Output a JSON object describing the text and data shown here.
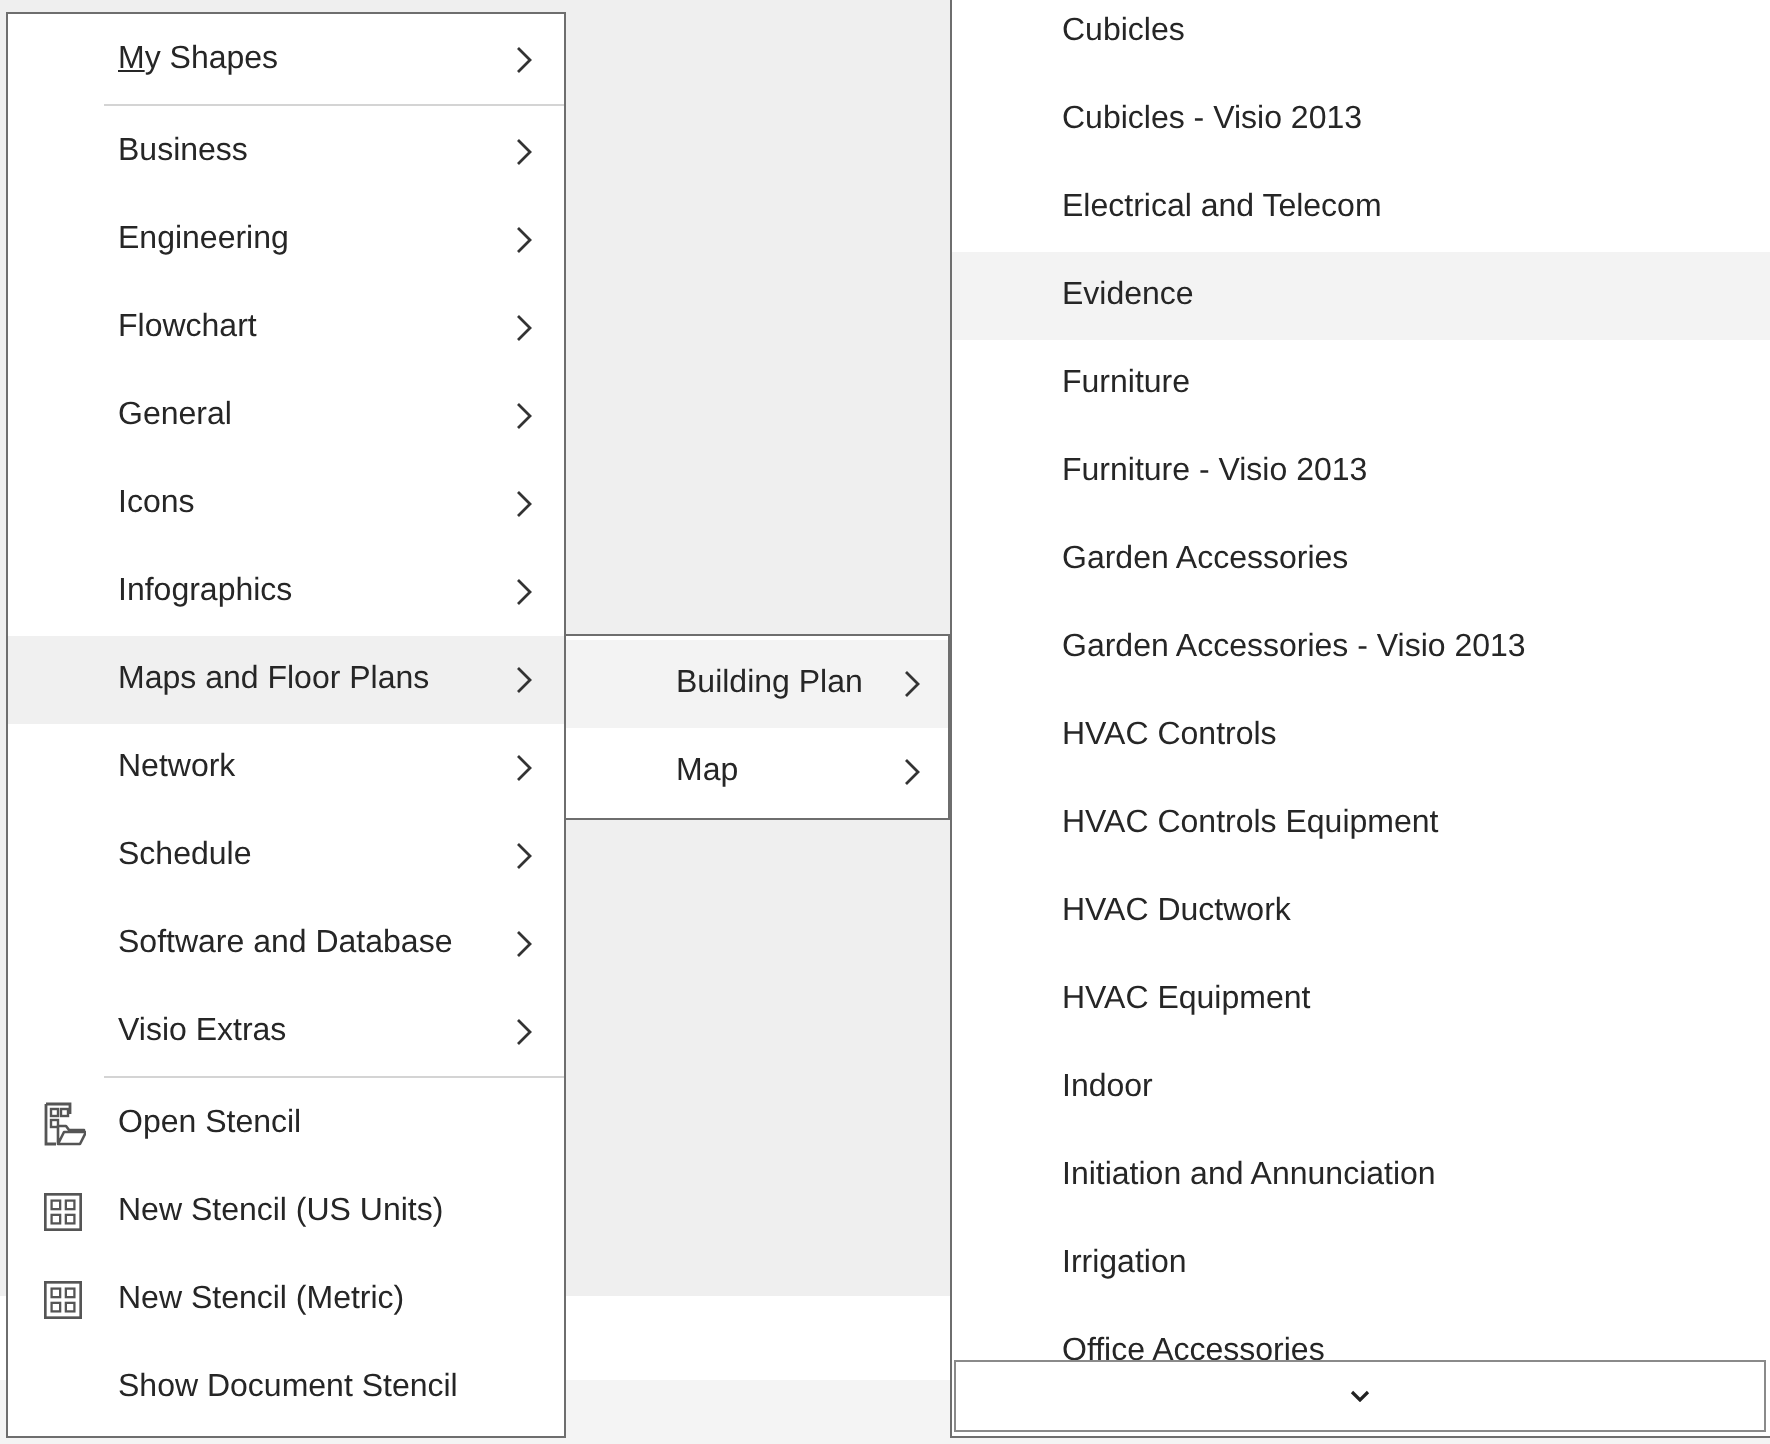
{
  "shapes_menu": {
    "sections": [
      {
        "items": [
          {
            "label": "My Shapes",
            "kind": "submenu",
            "selected": false,
            "access_key_underlined": true
          }
        ]
      },
      {
        "items": [
          {
            "label": "Business",
            "kind": "submenu",
            "selected": false,
            "access_key_underlined": false
          },
          {
            "label": "Engineering",
            "kind": "submenu",
            "selected": false,
            "access_key_underlined": false
          },
          {
            "label": "Flowchart",
            "kind": "submenu",
            "selected": false,
            "access_key_underlined": false
          },
          {
            "label": "General",
            "kind": "submenu",
            "selected": false,
            "access_key_underlined": false
          },
          {
            "label": "Icons",
            "kind": "submenu",
            "selected": false,
            "access_key_underlined": false
          },
          {
            "label": "Infographics",
            "kind": "submenu",
            "selected": false,
            "access_key_underlined": false
          },
          {
            "label": "Maps and Floor Plans",
            "kind": "submenu",
            "selected": true,
            "access_key_underlined": false
          },
          {
            "label": "Network",
            "kind": "submenu",
            "selected": false,
            "access_key_underlined": false
          },
          {
            "label": "Schedule",
            "kind": "submenu",
            "selected": false,
            "access_key_underlined": false
          },
          {
            "label": "Software and Database",
            "kind": "submenu",
            "selected": false,
            "access_key_underlined": false
          },
          {
            "label": "Visio Extras",
            "kind": "submenu",
            "selected": false,
            "access_key_underlined": false
          }
        ]
      },
      {
        "items": [
          {
            "label": "Open Stencil",
            "kind": "open",
            "selected": false,
            "access_key_underlined": false
          },
          {
            "label": "New Stencil (US Units)",
            "kind": "create",
            "selected": false,
            "access_key_underlined": false
          },
          {
            "label": "New Stencil (Metric)",
            "kind": "create",
            "selected": false,
            "access_key_underlined": false
          },
          {
            "label": "Show Document Stencil",
            "kind": "show",
            "selected": false,
            "access_key_underlined": false
          }
        ]
      }
    ]
  },
  "submenu": {
    "items": [
      {
        "label": "Building Plan",
        "kind": "submenu",
        "selected": true
      },
      {
        "label": "Map",
        "kind": "submenu",
        "selected": false
      }
    ]
  },
  "stencil_list": {
    "items": [
      {
        "label": "Cubicles",
        "selected": false
      },
      {
        "label": "Cubicles - Visio 2013",
        "selected": false
      },
      {
        "label": "Electrical and Telecom",
        "selected": false
      },
      {
        "label": "Evidence",
        "selected": true
      },
      {
        "label": "Furniture",
        "selected": false
      },
      {
        "label": "Furniture - Visio 2013",
        "selected": false
      },
      {
        "label": "Garden Accessories",
        "selected": false
      },
      {
        "label": "Garden Accessories - Visio 2013",
        "selected": false
      },
      {
        "label": "HVAC Controls",
        "selected": false
      },
      {
        "label": "HVAC Controls Equipment",
        "selected": false
      },
      {
        "label": "HVAC Ductwork",
        "selected": false
      },
      {
        "label": "HVAC Equipment",
        "selected": false
      },
      {
        "label": "Indoor",
        "selected": false
      },
      {
        "label": "Initiation and Annunciation",
        "selected": false
      },
      {
        "label": "Irrigation",
        "selected": false
      },
      {
        "label": "Office Accessories",
        "selected": false
      }
    ],
    "more_below": true
  }
}
